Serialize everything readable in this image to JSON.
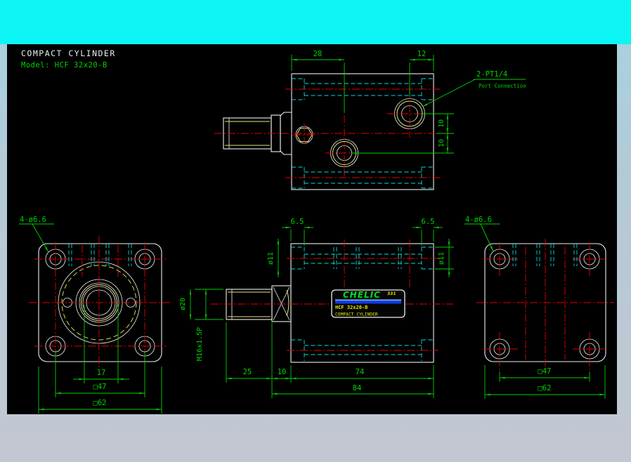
{
  "header": {
    "title": "COMPACT CYLINDER",
    "model": "Model:  HCF 32x20-B"
  },
  "top_view": {
    "dim_28": "28",
    "dim_12": "12",
    "dim_10a": "10",
    "dim_10b": "10",
    "port_label": "2-PT1/4",
    "port_sublabel": "Port Connection"
  },
  "front_view": {
    "holes_label": "4-ø6.6",
    "dim_17": "17",
    "dim_47": "□47",
    "dim_62": "□62"
  },
  "side_view": {
    "dim_65_left": "6.5",
    "dim_65_right": "6.5",
    "dim_11_left": "ø11",
    "dim_11_right": "ø11",
    "dim_20": "ø20",
    "dim_thread": "M16x1.5P",
    "dim_25": "25",
    "dim_10": "10",
    "dim_74": "74",
    "dim_84": "84",
    "nameplate": {
      "brand": "CHELIC",
      "mark": "331",
      "model": "HCF 32x20-B",
      "product": "COMPACT CYLINDER"
    }
  },
  "back_view": {
    "holes_label": "4-ø6.6",
    "dim_47": "□47",
    "dim_62": "□62"
  },
  "colors": {
    "canvas": "#000000",
    "top_bar": "#0cf4f4",
    "outline": "#f0f0f0",
    "dimension": "#00d200",
    "centerline": "#e60000",
    "hidden": "#00dcdc",
    "accent_yellow": "#e9e97c",
    "plate_stripe": "#1238e8"
  }
}
